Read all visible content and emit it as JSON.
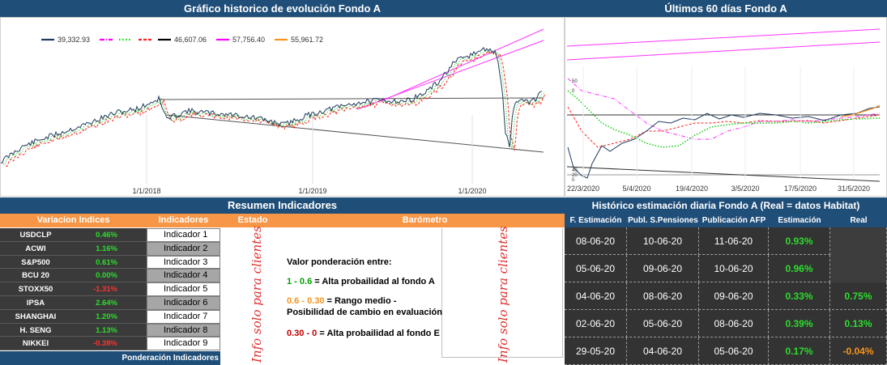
{
  "main_chart": {
    "title": "Gráfico historico de evolución Fondo A",
    "legend": [
      {
        "color": "#1f3a5f",
        "style": "solid",
        "value": "39,332.93"
      },
      {
        "color": "#ff00ff",
        "style": "dashdot",
        "value": ""
      },
      {
        "color": "#00dd00",
        "style": "dotted",
        "value": ""
      },
      {
        "color": "#ff2020",
        "style": "dashed",
        "value": ""
      },
      {
        "color": "#000000",
        "style": "solid",
        "value": "46,607.06"
      },
      {
        "color": "#ff00ff",
        "style": "solid",
        "value": "57,756.40"
      },
      {
        "color": "#f7941d",
        "style": "solid",
        "value": "55,961.72"
      }
    ],
    "x_ticks": [
      "1/1/2018",
      "1/1/2019",
      "1/1/2020"
    ]
  },
  "side_chart": {
    "title": "Últimos 60 días Fondo A",
    "y_ticks_top": [
      "50",
      "0"
    ],
    "y_ticks_bottom": [
      "40",
      "20",
      "0"
    ],
    "x_ticks": [
      "22/3/2020",
      "5/4/2020",
      "19/4/2020",
      "3/5/2020",
      "17/5/2020",
      "31/5/2020"
    ]
  },
  "resumen": {
    "title": "Resumen Indicadores",
    "headers": {
      "variacion": "Variacion Indices",
      "indicadores": "Indicadores",
      "estado": "Estado",
      "barometro": "Barómetro"
    },
    "indices": [
      {
        "name": "USDCLP",
        "value": "0.46%",
        "sign": "pos"
      },
      {
        "name": "ACWI",
        "value": "1.16%",
        "sign": "pos"
      },
      {
        "name": "S&P500",
        "value": "0.61%",
        "sign": "pos"
      },
      {
        "name": "BCU 20",
        "value": "0.00%",
        "sign": "pos"
      },
      {
        "name": "STOXX50",
        "value": "-1.31%",
        "sign": "neg"
      },
      {
        "name": "IPSA",
        "value": "2.64%",
        "sign": "pos"
      },
      {
        "name": "SHANGHAI",
        "value": "1.20%",
        "sign": "pos"
      },
      {
        "name": "H. SENG",
        "value": "1.13%",
        "sign": "pos"
      },
      {
        "name": "NIKKEI",
        "value": "-0.38%",
        "sign": "neg"
      }
    ],
    "indicadores": [
      "Indicador 1",
      "Indicador 2",
      "Indicador 3",
      "Indicador 4",
      "Indicador 5",
      "Indicador 6",
      "Indicador 7",
      "Indicador 8",
      "Indicador 9"
    ],
    "ponderacion_label": "Ponderación Indicadores",
    "watermark": "Info solo para clientes",
    "barometro": {
      "intro": "Valor ponderación entre:",
      "line1_range": "1 - 0.6",
      "line1_text": " = Alta probailidad al fondo A",
      "line2_range": "0.6 - 0.30",
      "line2_text": " = Rango medio -",
      "line2_cont": "Posibilidad de cambio en evaluación",
      "line3_range": "0.30 - 0",
      "line3_text": " = Alta probailidad al fondo E"
    }
  },
  "historico": {
    "title": "Histórico estimación diaria Fondo A (Real = datos Habitat)",
    "headers": [
      "F. Estimación",
      "Publ. S.Pensiones",
      "Publicación AFP",
      "Estimación",
      "Real"
    ],
    "rows": [
      {
        "f_est": "08-06-20",
        "publ": "10-06-20",
        "afp": "11-06-20",
        "est": "0.93%",
        "real": "",
        "real_color": ""
      },
      {
        "f_est": "05-06-20",
        "publ": "09-06-20",
        "afp": "10-06-20",
        "est": "0.96%",
        "real": "",
        "real_color": ""
      },
      {
        "f_est": "04-06-20",
        "publ": "08-06-20",
        "afp": "09-06-20",
        "est": "0.33%",
        "real": "0.75%",
        "real_color": "grn"
      },
      {
        "f_est": "02-06-20",
        "publ": "05-06-20",
        "afp": "08-06-20",
        "est": "0.39%",
        "real": "0.13%",
        "real_color": "grn"
      },
      {
        "f_est": "29-05-20",
        "publ": "04-06-20",
        "afp": "05-06-20",
        "est": "0.17%",
        "real": "-0.04%",
        "real_color": "org"
      }
    ]
  }
}
